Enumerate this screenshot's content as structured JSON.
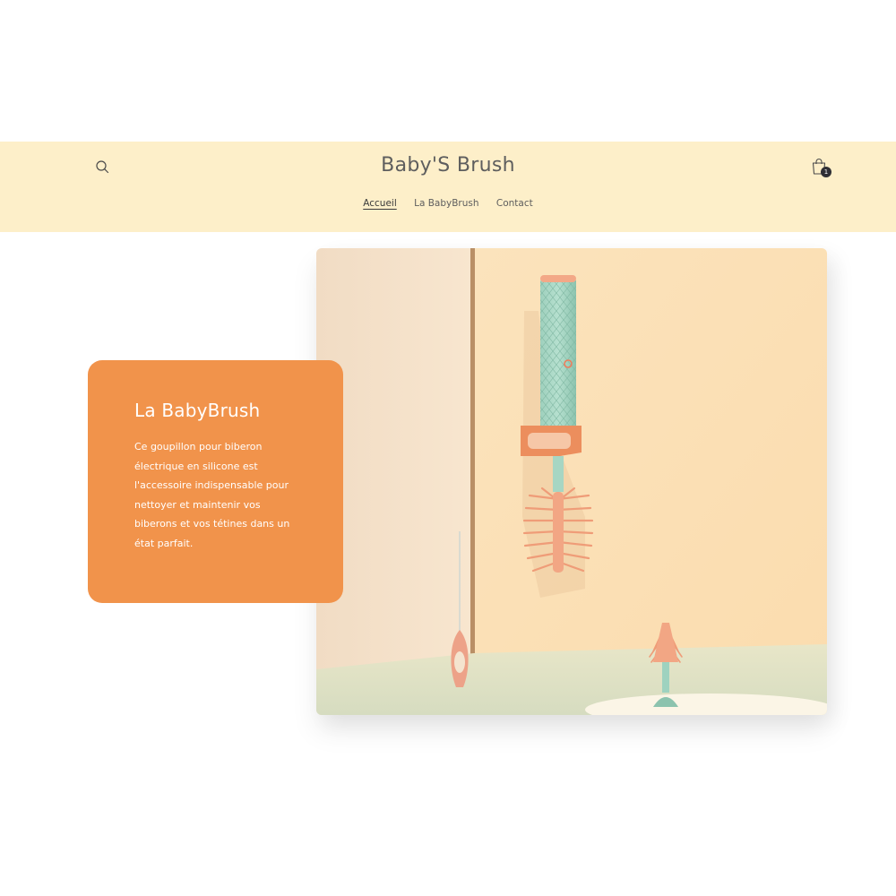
{
  "header": {
    "brand": "Baby'S Brush",
    "search_icon": "search-icon",
    "cart_icon": "shopping-bag-icon",
    "cart_count": "1",
    "background_color": "#fdefc9"
  },
  "nav": {
    "items": [
      {
        "label": "Accueil",
        "active": true
      },
      {
        "label": "La BabyBrush",
        "active": false
      },
      {
        "label": "Contact",
        "active": false
      }
    ]
  },
  "hero": {
    "title": "La BabyBrush",
    "description": "Ce goupillon pour biberon électrique en silicone est l'accessoire indispensable pour nettoyer et maintenir vos biberons et vos tétines dans un état parfait.",
    "card_color": "#f1934b",
    "image": "product-photo"
  }
}
